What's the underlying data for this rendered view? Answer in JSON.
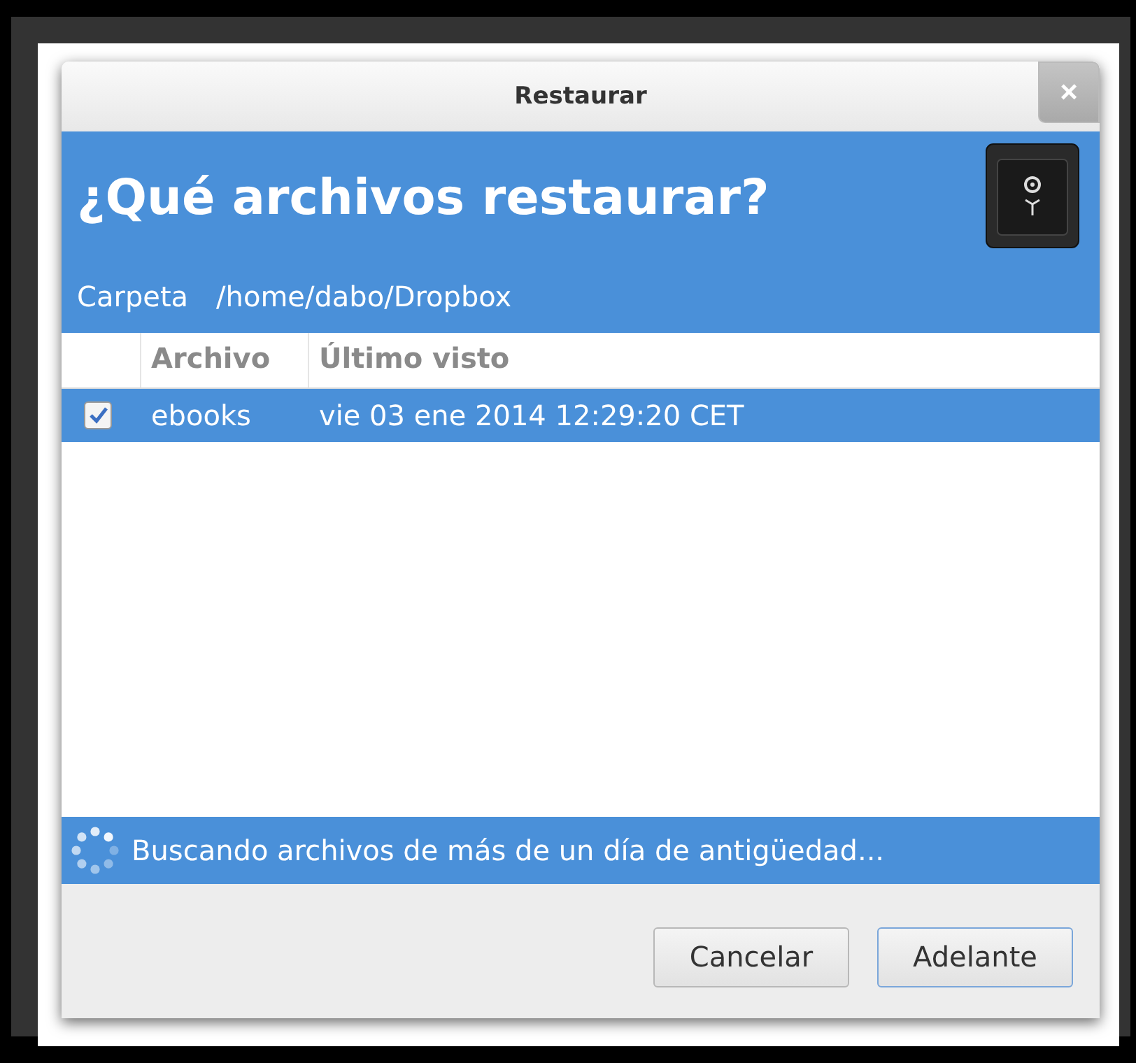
{
  "window": {
    "title": "Restaurar",
    "close": "×"
  },
  "header": {
    "title": "¿Qué archivos restaurar?",
    "folder_label": "Carpeta",
    "folder_path": "/home/dabo/Dropbox"
  },
  "table": {
    "columns": [
      "Archivo",
      "Último visto"
    ],
    "rows": [
      {
        "name": "ebooks",
        "last_seen": "vie 03 ene 2014 12:29:20 CET",
        "checked": true,
        "selected": true
      }
    ]
  },
  "status": {
    "text": "Buscando archivos de más de un día de antigüedad..."
  },
  "buttons": [
    {
      "label": "Cancelar",
      "default": false
    },
    {
      "label": "Adelante",
      "default": true
    }
  ]
}
